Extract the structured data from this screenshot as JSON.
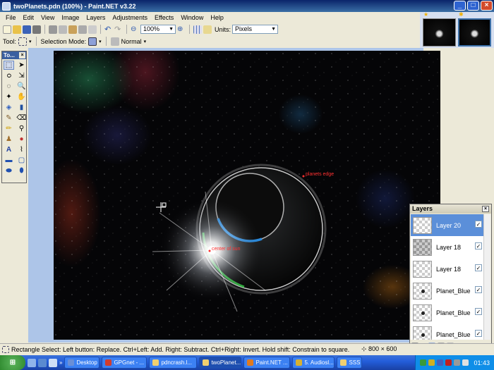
{
  "window": {
    "title": "twoPlanets.pdn (100%) - Paint.NET v3.22"
  },
  "menu": [
    "File",
    "Edit",
    "View",
    "Image",
    "Layers",
    "Adjustments",
    "Effects",
    "Window",
    "Help"
  ],
  "toolbar": {
    "zoom_value": "100%",
    "units_label": "Units:",
    "units_value": "Pixels"
  },
  "toolbar2": {
    "tool_label": "Tool:",
    "selection_mode_label": "Selection Mode:",
    "blend_value": "Normal"
  },
  "tools_panel": {
    "title": "To..."
  },
  "canvas": {
    "annotations": {
      "planets_edge": "planets edge",
      "center_of_sun": "center of sun"
    }
  },
  "layers_panel": {
    "title": "Layers",
    "items": [
      {
        "name": "Layer 20",
        "selected": true,
        "visible": true,
        "thumb": "checker"
      },
      {
        "name": "Layer 18",
        "selected": false,
        "visible": true,
        "thumb": "checker-dark"
      },
      {
        "name": "Layer 18",
        "selected": false,
        "visible": true,
        "thumb": "checker"
      },
      {
        "name": "Planet_Blue",
        "selected": false,
        "visible": true,
        "thumb": "dot"
      },
      {
        "name": "Planet_Blue",
        "selected": false,
        "visible": true,
        "thumb": "dot"
      },
      {
        "name": "Planet_Blue",
        "selected": false,
        "visible": true,
        "thumb": "dot"
      }
    ]
  },
  "statusbar": {
    "hint": "Rectangle Select: Left button: Replace. Ctrl+Left: Add. Right: Subtract. Ctrl+Right: Invert. Hold shift: Constrain to square.",
    "image_size": "800 × 600"
  },
  "taskbar": {
    "tasks": [
      {
        "label": "Desktop",
        "icon_color": "#6b8fd6"
      },
      {
        "label": "GPGnet - ...",
        "icon_color": "#d23c2c"
      },
      {
        "label": "pdncrash.l...",
        "icon_color": "#f0d070"
      },
      {
        "label": "twoPlanet...",
        "icon_color": "#f0d070"
      },
      {
        "label": "Paint.NET ...",
        "icon_color": "#e07a20"
      },
      {
        "label": "5. Audiosl...",
        "icon_color": "#d8b030"
      },
      {
        "label": "SSS",
        "icon_color": "#f0d070"
      }
    ],
    "clock": "01:43"
  },
  "colors": {
    "title_bar": "#0a246a",
    "workspace": "#adc5e8",
    "layer_selected": "#5b8fd9",
    "annotation": "#ff3030"
  }
}
